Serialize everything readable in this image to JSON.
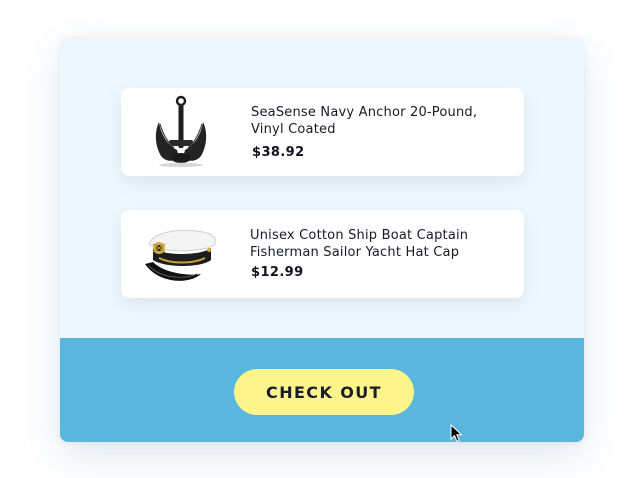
{
  "cart": {
    "items": [
      {
        "name": "SeaSense Navy Anchor 20-Pound, Vinyl Coated",
        "price": "$38.92",
        "image_icon": "anchor-image"
      },
      {
        "name": "Unisex Cotton Ship Boat Captain Fisherman Sailor Yacht Hat Cap",
        "price": "$12.99",
        "image_icon": "captain-hat-image"
      }
    ],
    "checkout_label": "CHECK OUT"
  },
  "colors": {
    "card_background": "#eef7fd",
    "footer_background": "#5bb6dd",
    "button_background": "#fdf58a",
    "text": "#1a1a2a"
  }
}
